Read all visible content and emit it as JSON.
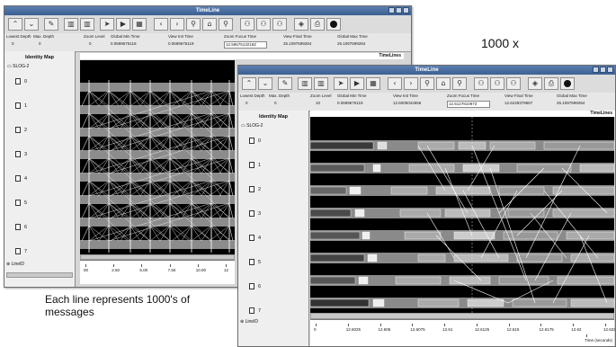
{
  "zoom_label": "1000 x",
  "caption": "Each line represents 1000's of messages",
  "window1": {
    "title": "TimeLine",
    "toolbar_icons": [
      "up-arrow-icon",
      "down-arrow-icon",
      "edit-icon",
      "delete-icon",
      "forward-icon",
      "play-icon",
      "grid-icon",
      "back-icon",
      "forward-icon",
      "zoom-in-icon",
      "home-icon",
      "zoom-out-icon",
      "search-icon",
      "search-all-icon",
      "search-next-icon",
      "filter-icon",
      "print-icon",
      "record-icon"
    ],
    "info": {
      "lowest_depth_label": "Lowest Depth",
      "lowest_depth": "0",
      "max_depth_label": "Max. Depth",
      "max_depth": "0",
      "zoom_level_label": "Zoom Level",
      "zoom_level": "0",
      "global_min_label": "Global Min Time",
      "global_min": "0.0699675119",
      "view_init_label": "View Init Time",
      "view_init": "0.0699675119",
      "zoom_focus_label": "Zoom Focus Time",
      "zoom_focus": "12.5967513219Z",
      "view_final_label": "View Final Time",
      "view_final": "25.1097599284",
      "global_max_label": "Global Max Time",
      "global_max": "25.1097599284"
    },
    "identity_map": "Identity Map",
    "root": "SLOG-2",
    "nodes": [
      "0",
      "1",
      "2",
      "3",
      "4",
      "5",
      "6",
      "7"
    ],
    "line_id": "LineID",
    "timelines": "TimeLines",
    "ticks": [
      "00",
      "2.50",
      "5.00",
      "7.50",
      "10.00",
      "12"
    ]
  },
  "window2": {
    "title": "TimeLine",
    "info": {
      "lowest_depth_label": "Lowest Depth",
      "lowest_depth": "0",
      "max_depth_label": "Max. Depth",
      "max_depth": "0",
      "zoom_level_label": "Zoom Level",
      "zoom_level": "10",
      "global_min_label": "Global Min Time",
      "global_min": "0.0699675119",
      "view_init_label": "View Init Time",
      "view_init": "12.6005042656",
      "zoom_focus_label": "Zoom Focus Time",
      "zoom_focus": "12.6127810973",
      "view_final_label": "View Final Time",
      "view_final": "12.6249379667",
      "global_max_label": "Global Max Time",
      "global_max": "25.1097599284"
    },
    "identity_map": "Identity Map",
    "root": "SLOG-2",
    "nodes": [
      "0",
      "1",
      "2",
      "3",
      "4",
      "5",
      "6",
      "7"
    ],
    "line_id": "LineID",
    "timelines": "TimeLines",
    "ticks": [
      "0",
      "12.6025",
      "12.605",
      "12.6075",
      "12.61",
      "12.6125",
      "12.615",
      "12.6175",
      "12.62",
      "12.6225"
    ],
    "axis_unit": "Time (seconds)"
  }
}
